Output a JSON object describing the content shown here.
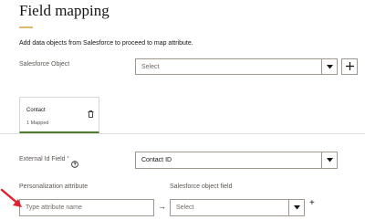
{
  "page": {
    "title": "Field mapping",
    "subtitle": "Add data objects from Salesforce to proceed to map attribute.",
    "accent_color": "#e2b86b"
  },
  "salesforce_object": {
    "label": "Salesforce Object",
    "selected": "Select",
    "add_icon": "plus-icon"
  },
  "card": {
    "title": "Contact",
    "subtitle": "1 Mapped",
    "delete_icon": "trash-icon",
    "accent_color": "#4f7b33"
  },
  "external_id": {
    "label": "External Id Field",
    "required_mark": "*",
    "help_icon": "help-circle-icon",
    "selected": "Contact ID"
  },
  "mapping": {
    "personalization_label": "Personalization attribute",
    "salesforce_field_label": "Salesforce object field",
    "attribute_placeholder": "Type attribute name",
    "arrow": "→",
    "field_selected": "Select",
    "add_symbol": "+"
  },
  "annotation": {
    "arrow_color": "#e0202a"
  }
}
